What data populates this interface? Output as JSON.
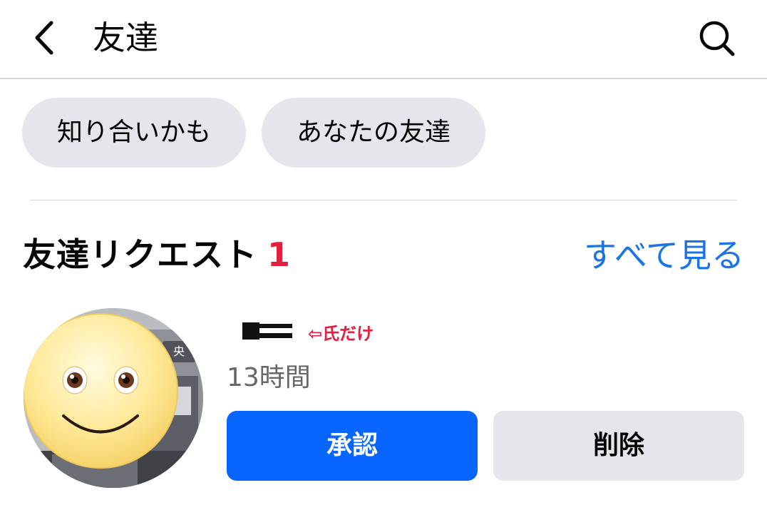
{
  "header": {
    "title": "友達"
  },
  "tabs": [
    {
      "label": "知り合いかも"
    },
    {
      "label": "あなたの友達"
    }
  ],
  "friend_requests": {
    "title": "友達リクエスト",
    "count": "1",
    "see_all_label": "すべて見る",
    "items": [
      {
        "name_note": "⇦氏だけ",
        "time": "13時間",
        "approve_label": "承認",
        "delete_label": "削除"
      }
    ]
  },
  "colors": {
    "primary": "#0866ff",
    "link": "#1b74e4",
    "badge": "#e41e3f",
    "chip_bg": "#e4e6eb"
  }
}
